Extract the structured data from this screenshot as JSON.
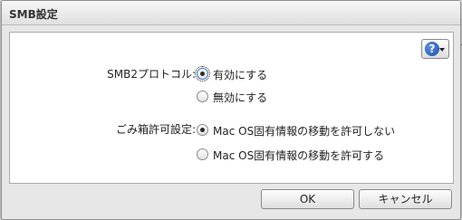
{
  "dialog": {
    "title": "SMB設定"
  },
  "help": {
    "icon": "help-icon",
    "symbol": "?"
  },
  "smb2": {
    "label": "SMB2プロトコル:",
    "options": [
      {
        "label": "有効にする",
        "selected": true
      },
      {
        "label": "無効にする",
        "selected": false
      }
    ]
  },
  "trash": {
    "label": "ごみ箱許可設定:",
    "options": [
      {
        "label": "Mac OS固有情報の移動を許可しない",
        "selected": true
      },
      {
        "label": "Mac OS固有情報の移動を許可する",
        "selected": false
      }
    ]
  },
  "buttons": {
    "ok": "OK",
    "cancel": "キャンセル"
  }
}
